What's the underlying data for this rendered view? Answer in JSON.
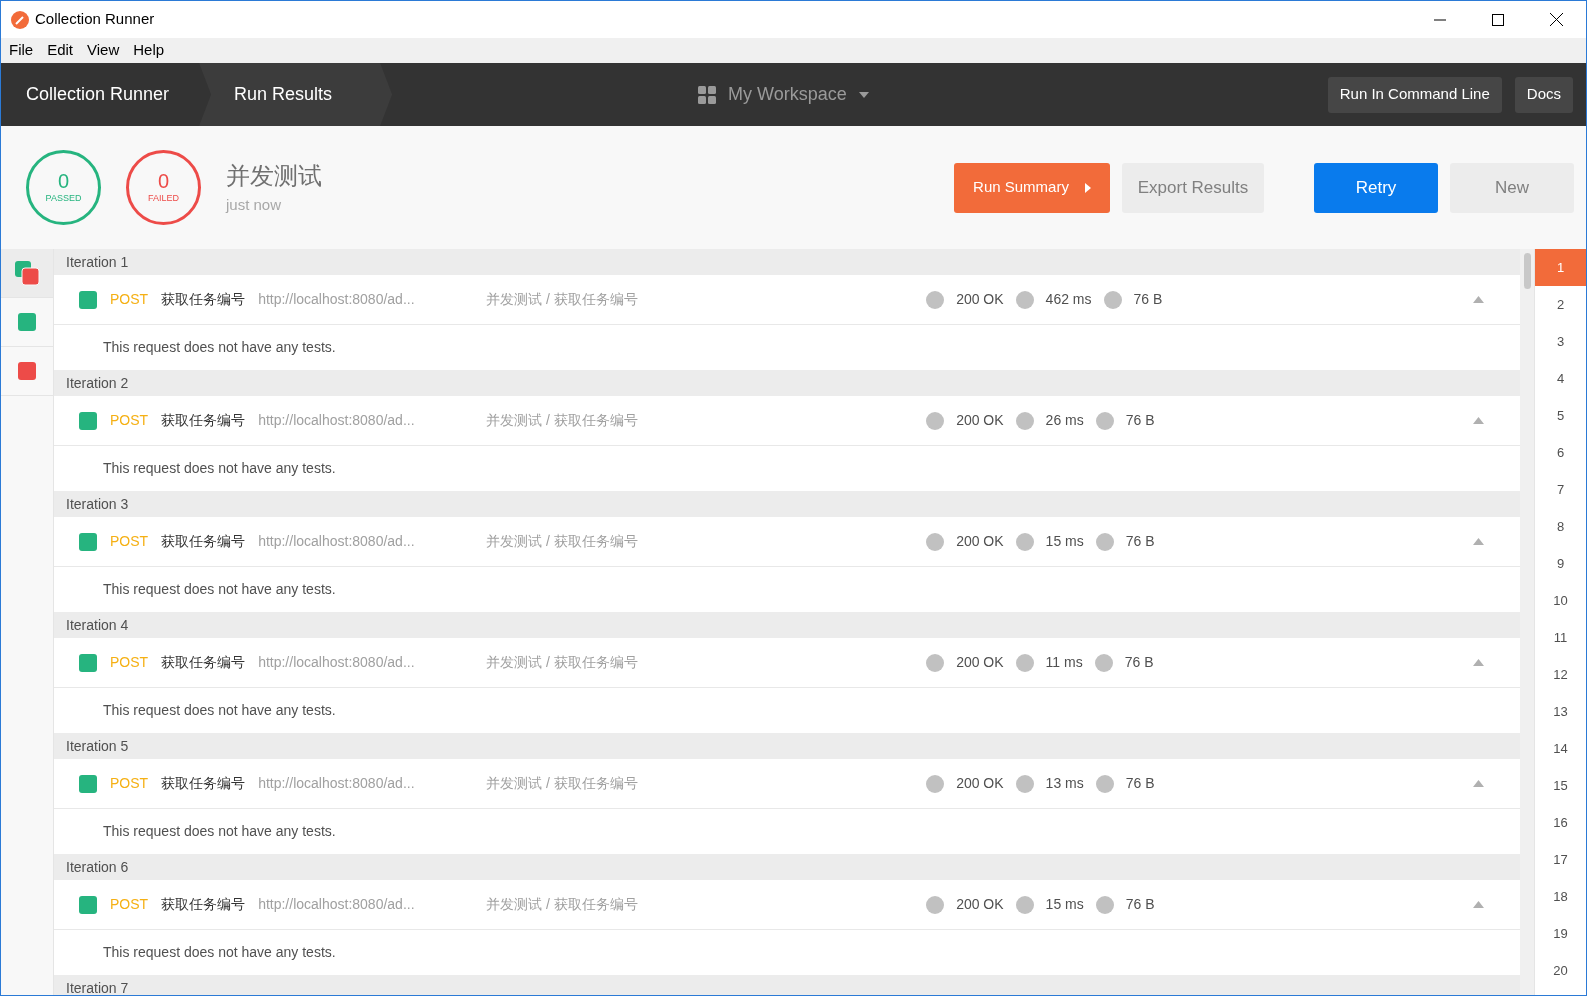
{
  "window": {
    "title": "Collection Runner"
  },
  "menu": [
    "File",
    "Edit",
    "View",
    "Help"
  ],
  "breadcrumbs": [
    "Collection Runner",
    "Run Results"
  ],
  "workspace": {
    "label": "My Workspace"
  },
  "header_buttons": [
    "Run In Command Line",
    "Docs"
  ],
  "summary": {
    "passed": {
      "count": "0",
      "label": "PASSED"
    },
    "failed": {
      "count": "0",
      "label": "FAILED"
    },
    "name": "并发测试",
    "time": "just now"
  },
  "actions": [
    {
      "label": "Run Summary",
      "kind": "summary"
    },
    {
      "label": "Export Results",
      "kind": "secondary"
    },
    {
      "label": "Retry",
      "kind": "primary"
    },
    {
      "label": "New",
      "kind": "secondary"
    }
  ],
  "filters": [
    {
      "kind": "all",
      "selected": true
    },
    {
      "kind": "passed",
      "selected": false
    },
    {
      "kind": "failed",
      "selected": false
    }
  ],
  "iterations": [
    {
      "title": "Iteration 1",
      "method": "POST",
      "name": "获取任务编号",
      "url": "http://localhost:8080/ad...",
      "path": "并发测试 / 获取任务编号",
      "status": "200 OK",
      "time": "462 ms",
      "size": "76 B",
      "expanded": true,
      "message": "This request does not have any tests."
    },
    {
      "title": "Iteration 2",
      "method": "POST",
      "name": "获取任务编号",
      "url": "http://localhost:8080/ad...",
      "path": "并发测试 / 获取任务编号",
      "status": "200 OK",
      "time": "26 ms",
      "size": "76 B",
      "expanded": true,
      "message": "This request does not have any tests."
    },
    {
      "title": "Iteration 3",
      "method": "POST",
      "name": "获取任务编号",
      "url": "http://localhost:8080/ad...",
      "path": "并发测试 / 获取任务编号",
      "status": "200 OK",
      "time": "15 ms",
      "size": "76 B",
      "expanded": true,
      "message": "This request does not have any tests."
    },
    {
      "title": "Iteration 4",
      "method": "POST",
      "name": "获取任务编号",
      "url": "http://localhost:8080/ad...",
      "path": "并发测试 / 获取任务编号",
      "status": "200 OK",
      "time": "11 ms",
      "size": "76 B",
      "expanded": true,
      "message": "This request does not have any tests."
    },
    {
      "title": "Iteration 5",
      "method": "POST",
      "name": "获取任务编号",
      "url": "http://localhost:8080/ad...",
      "path": "并发测试 / 获取任务编号",
      "status": "200 OK",
      "time": "13 ms",
      "size": "76 B",
      "expanded": true,
      "message": "This request does not have any tests."
    },
    {
      "title": "Iteration 6",
      "method": "POST",
      "name": "获取任务编号",
      "url": "http://localhost:8080/ad...",
      "path": "并发测试 / 获取任务编号",
      "status": "200 OK",
      "time": "15 ms",
      "size": "76 B",
      "expanded": true,
      "message": "This request does not have any tests."
    },
    {
      "title": "Iteration 7"
    }
  ],
  "iteration_nav": [
    {
      "label": "1",
      "selected": true
    },
    {
      "label": "2",
      "selected": false
    },
    {
      "label": "3",
      "selected": false
    },
    {
      "label": "4",
      "selected": false
    },
    {
      "label": "5",
      "selected": false
    },
    {
      "label": "6",
      "selected": false
    },
    {
      "label": "7",
      "selected": false
    },
    {
      "label": "8",
      "selected": false
    },
    {
      "label": "9",
      "selected": false
    },
    {
      "label": "10",
      "selected": false
    },
    {
      "label": "11",
      "selected": false
    },
    {
      "label": "12",
      "selected": false
    },
    {
      "label": "13",
      "selected": false
    },
    {
      "label": "14",
      "selected": false
    },
    {
      "label": "15",
      "selected": false
    },
    {
      "label": "16",
      "selected": false
    },
    {
      "label": "17",
      "selected": false
    },
    {
      "label": "18",
      "selected": false
    },
    {
      "label": "19",
      "selected": false
    },
    {
      "label": "20",
      "selected": false
    }
  ]
}
